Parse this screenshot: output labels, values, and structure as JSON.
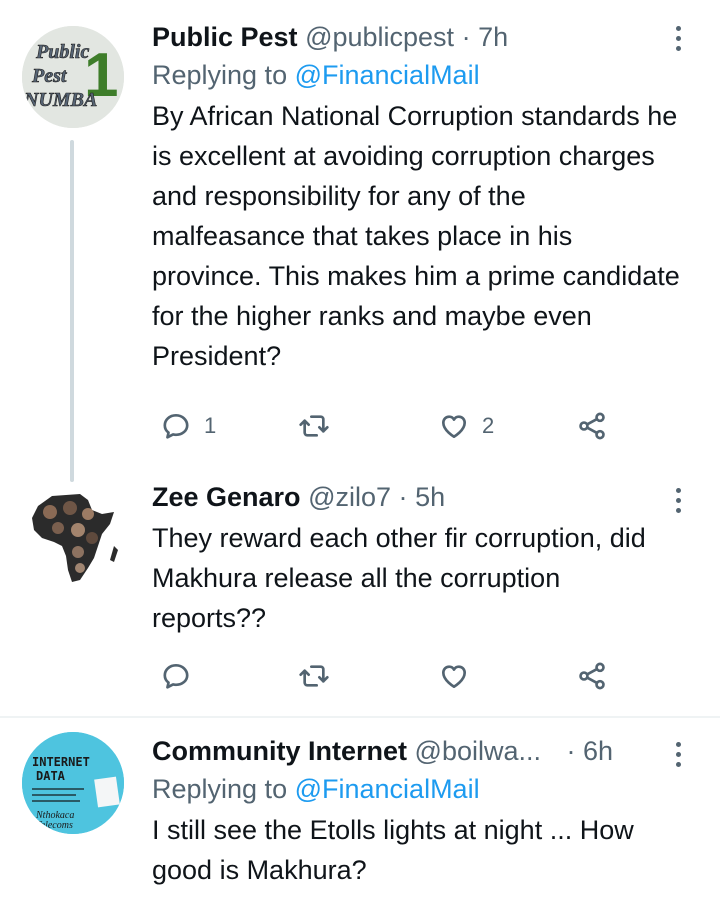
{
  "tweets": [
    {
      "name": "Public Pest",
      "handle": "@publicpest",
      "dot": "·",
      "time": "7h",
      "replying_prefix": "Replying to",
      "replying_to": "@FinancialMail",
      "text": "By African National Corruption standards he is excellent at avoiding corruption charges and responsibility for any of the malfeasance that takes place in his province. This makes him a prime candidate for the higher ranks and maybe even President?",
      "replies": "1",
      "retweets": "",
      "likes": "2",
      "avatar_text": [
        "Public",
        "Pest",
        "NUMBA",
        "1"
      ]
    },
    {
      "name": "Zee Genaro",
      "handle": "@zilo7",
      "dot": "·",
      "time": "5h",
      "text": "They reward each other fir corruption, did Makhura release all the corruption reports??",
      "replies": "",
      "retweets": "",
      "likes": ""
    },
    {
      "name": "Community Internet",
      "handle": "@boilwa...",
      "dot": "·",
      "time": "6h",
      "replying_prefix": "Replying to",
      "replying_to": "@FinancialMail",
      "text": "I still see the Etolls lights at night ... How good is Makhura?",
      "avatar_text": [
        "INTERNET",
        "DATA",
        "Nthokaca",
        "Telecoms"
      ]
    }
  ],
  "colors": {
    "accent": "#1d9bf0",
    "secondary_text": "#536471",
    "divider": "#eff3f4"
  },
  "icons": [
    "reply-icon",
    "retweet-icon",
    "like-icon",
    "share-icon",
    "more-icon"
  ]
}
